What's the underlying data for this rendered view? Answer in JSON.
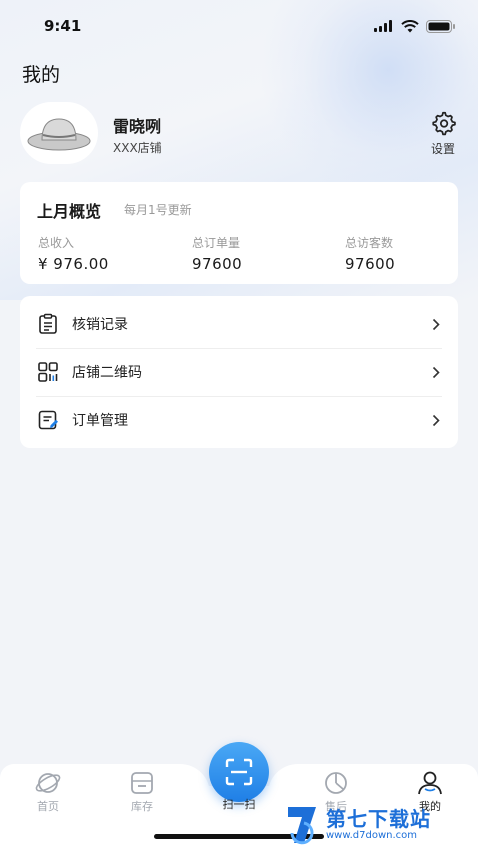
{
  "status_bar": {
    "time": "9:41"
  },
  "page": {
    "title": "我的"
  },
  "profile": {
    "name": "雷晓咧",
    "store": "XXX店铺",
    "settings_label": "设置"
  },
  "overview": {
    "title": "上月概览",
    "subtitle": "每月1号更新",
    "stats": [
      {
        "label": "总收入",
        "value": "¥ 976.00"
      },
      {
        "label": "总订单量",
        "value": "97600"
      },
      {
        "label": "总访客数",
        "value": "97600"
      }
    ]
  },
  "menu": {
    "items": [
      {
        "label": "核销记录",
        "icon": "clipboard-list-icon"
      },
      {
        "label": "店铺二维码",
        "icon": "qr-code-icon"
      },
      {
        "label": "订单管理",
        "icon": "order-edit-icon"
      }
    ]
  },
  "tabbar": {
    "tabs": [
      {
        "label": "首页",
        "icon": "planet-icon"
      },
      {
        "label": "库存",
        "icon": "inventory-box-icon"
      },
      {
        "label": "扫一扫",
        "icon": "scan-icon"
      },
      {
        "label": "售后",
        "icon": "clock-pie-icon"
      },
      {
        "label": "我的",
        "icon": "user-icon"
      }
    ],
    "active": "我的"
  },
  "watermark": {
    "title": "第七下载站",
    "url": "www.d7down.com"
  },
  "colors": {
    "accent": "#1f7fe6",
    "background": "#f2f4f8",
    "inactive_tab": "#a3a8b0"
  }
}
